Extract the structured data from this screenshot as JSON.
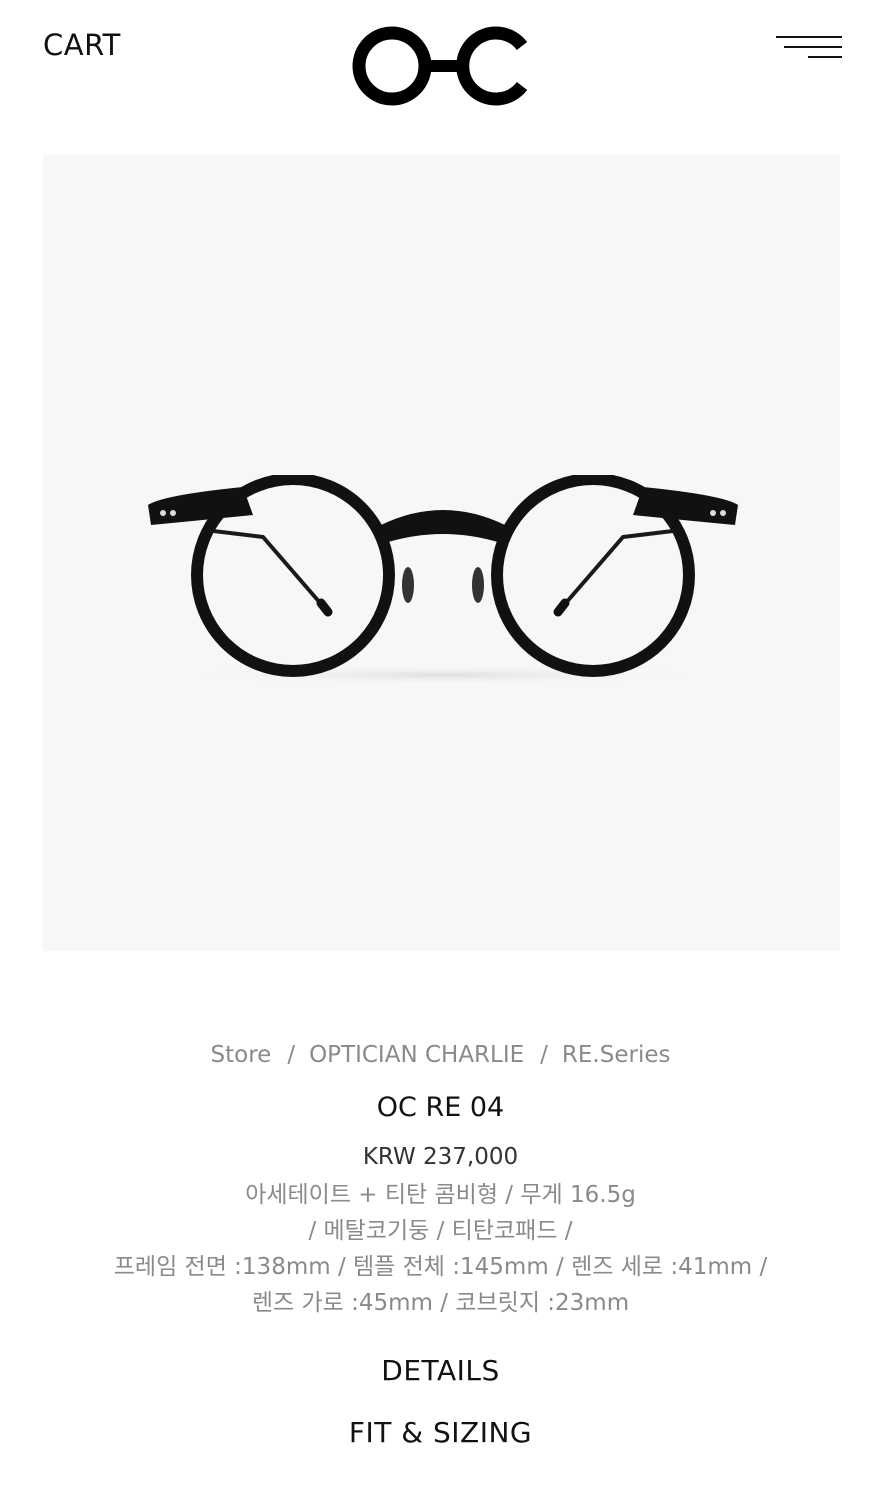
{
  "header": {
    "cart_label": "CART",
    "logo_text": "OC",
    "menu_icon": "hamburger-menu-icon"
  },
  "product_image": {
    "background": "#f7f7f8",
    "frame_color": "#111111"
  },
  "breadcrumb": {
    "items": [
      "Store",
      "OPTICIAN CHARLIE",
      "RE.Series"
    ],
    "separator": "/"
  },
  "product": {
    "title": "OC RE 04",
    "price": "KRW 237,000",
    "description_lines": [
      "아세테이트 + 티탄 콤비형 / 무게 16.5g",
      "/ 메탈코기둥 / 티탄코패드 /",
      "프레임 전면 :138mm / 템플 전체 :145mm / 렌즈 세로 :41mm /",
      "렌즈 가로 :45mm / 코브릿지 :23mm"
    ]
  },
  "sections": {
    "details_label": "DETAILS",
    "fit_label": "FIT & SIZING"
  }
}
